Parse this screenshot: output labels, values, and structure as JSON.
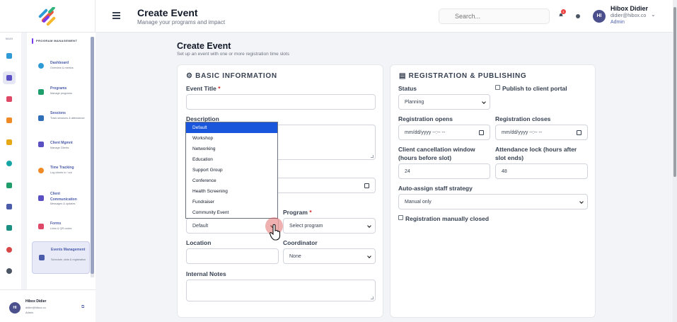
{
  "header": {
    "title": "Create Event",
    "subtitle": "Manage your programs and impact",
    "search_placeholder": "Search...",
    "notification_count": "1",
    "user": {
      "initials": "HI",
      "name": "Hibox Didier",
      "email": "didier@hibox.co",
      "role": "Admin"
    }
  },
  "rail": {
    "label": "MAIN"
  },
  "nav": {
    "heading": "PROGRAM MANAGEMENT",
    "items": [
      {
        "title": "Dashboard",
        "desc": "Overview & metrics"
      },
      {
        "title": "Programs",
        "desc": "Manage programs"
      },
      {
        "title": "Sessions",
        "desc": "Track sessions & attendance"
      },
      {
        "title": "Client Mgmnt",
        "desc": "Manage Clients"
      },
      {
        "title": "Time Tracking",
        "desc": "Log clients in / out"
      },
      {
        "title": "Client Communication",
        "desc": "Messages & updates"
      },
      {
        "title": "Forms",
        "desc": "Links & QR codes"
      },
      {
        "title": "Events Management",
        "desc": "Schedule, slots & registration"
      }
    ]
  },
  "footer_user": {
    "initials": "HI",
    "name": "Hibox Didier",
    "email": "didier@hibox.co",
    "role": "Admin"
  },
  "page": {
    "title": "Create Event",
    "subtitle": "Set up an event with one or more registration time slots"
  },
  "basic": {
    "title": "BASIC INFORMATION",
    "event_title_label": "Event Title",
    "event_title_value": "",
    "description_label": "Description",
    "event_type_value": "Default",
    "program_label": "Program",
    "program_value": "Select program",
    "location_label": "Location",
    "coordinator_label": "Coordinator",
    "coordinator_value": "None",
    "notes_label": "Internal Notes",
    "required_mark": "*"
  },
  "dropdown": {
    "options": [
      "Default",
      "Workshop",
      "Networking",
      "Education",
      "Support Group",
      "Conference",
      "Health Screening",
      "Fundraiser",
      "Community Event"
    ],
    "selected_index": 0
  },
  "registration": {
    "title": "REGISTRATION & PUBLISHING",
    "status_label": "Status",
    "status_value": "Planning",
    "publish_label": "Publish to client portal",
    "opens_label": "Registration opens",
    "opens_value": "mm/dd/yyyy --:-- --",
    "closes_label": "Registration closes",
    "closes_value": "mm/dd/yyyy --:-- --",
    "cancel_label": "Client cancellation window (hours before slot)",
    "cancel_value": "24",
    "lock_label": "Attendance lock (hours after slot ends)",
    "lock_value": "48",
    "staff_label": "Auto-assign staff strategy",
    "staff_value": "Manual only",
    "manual_close_label": "Registration manually closed"
  },
  "colors": {
    "accent": "#4b5faa",
    "brand_purple": "#7c3aed",
    "selected_option": "#1a56db"
  }
}
